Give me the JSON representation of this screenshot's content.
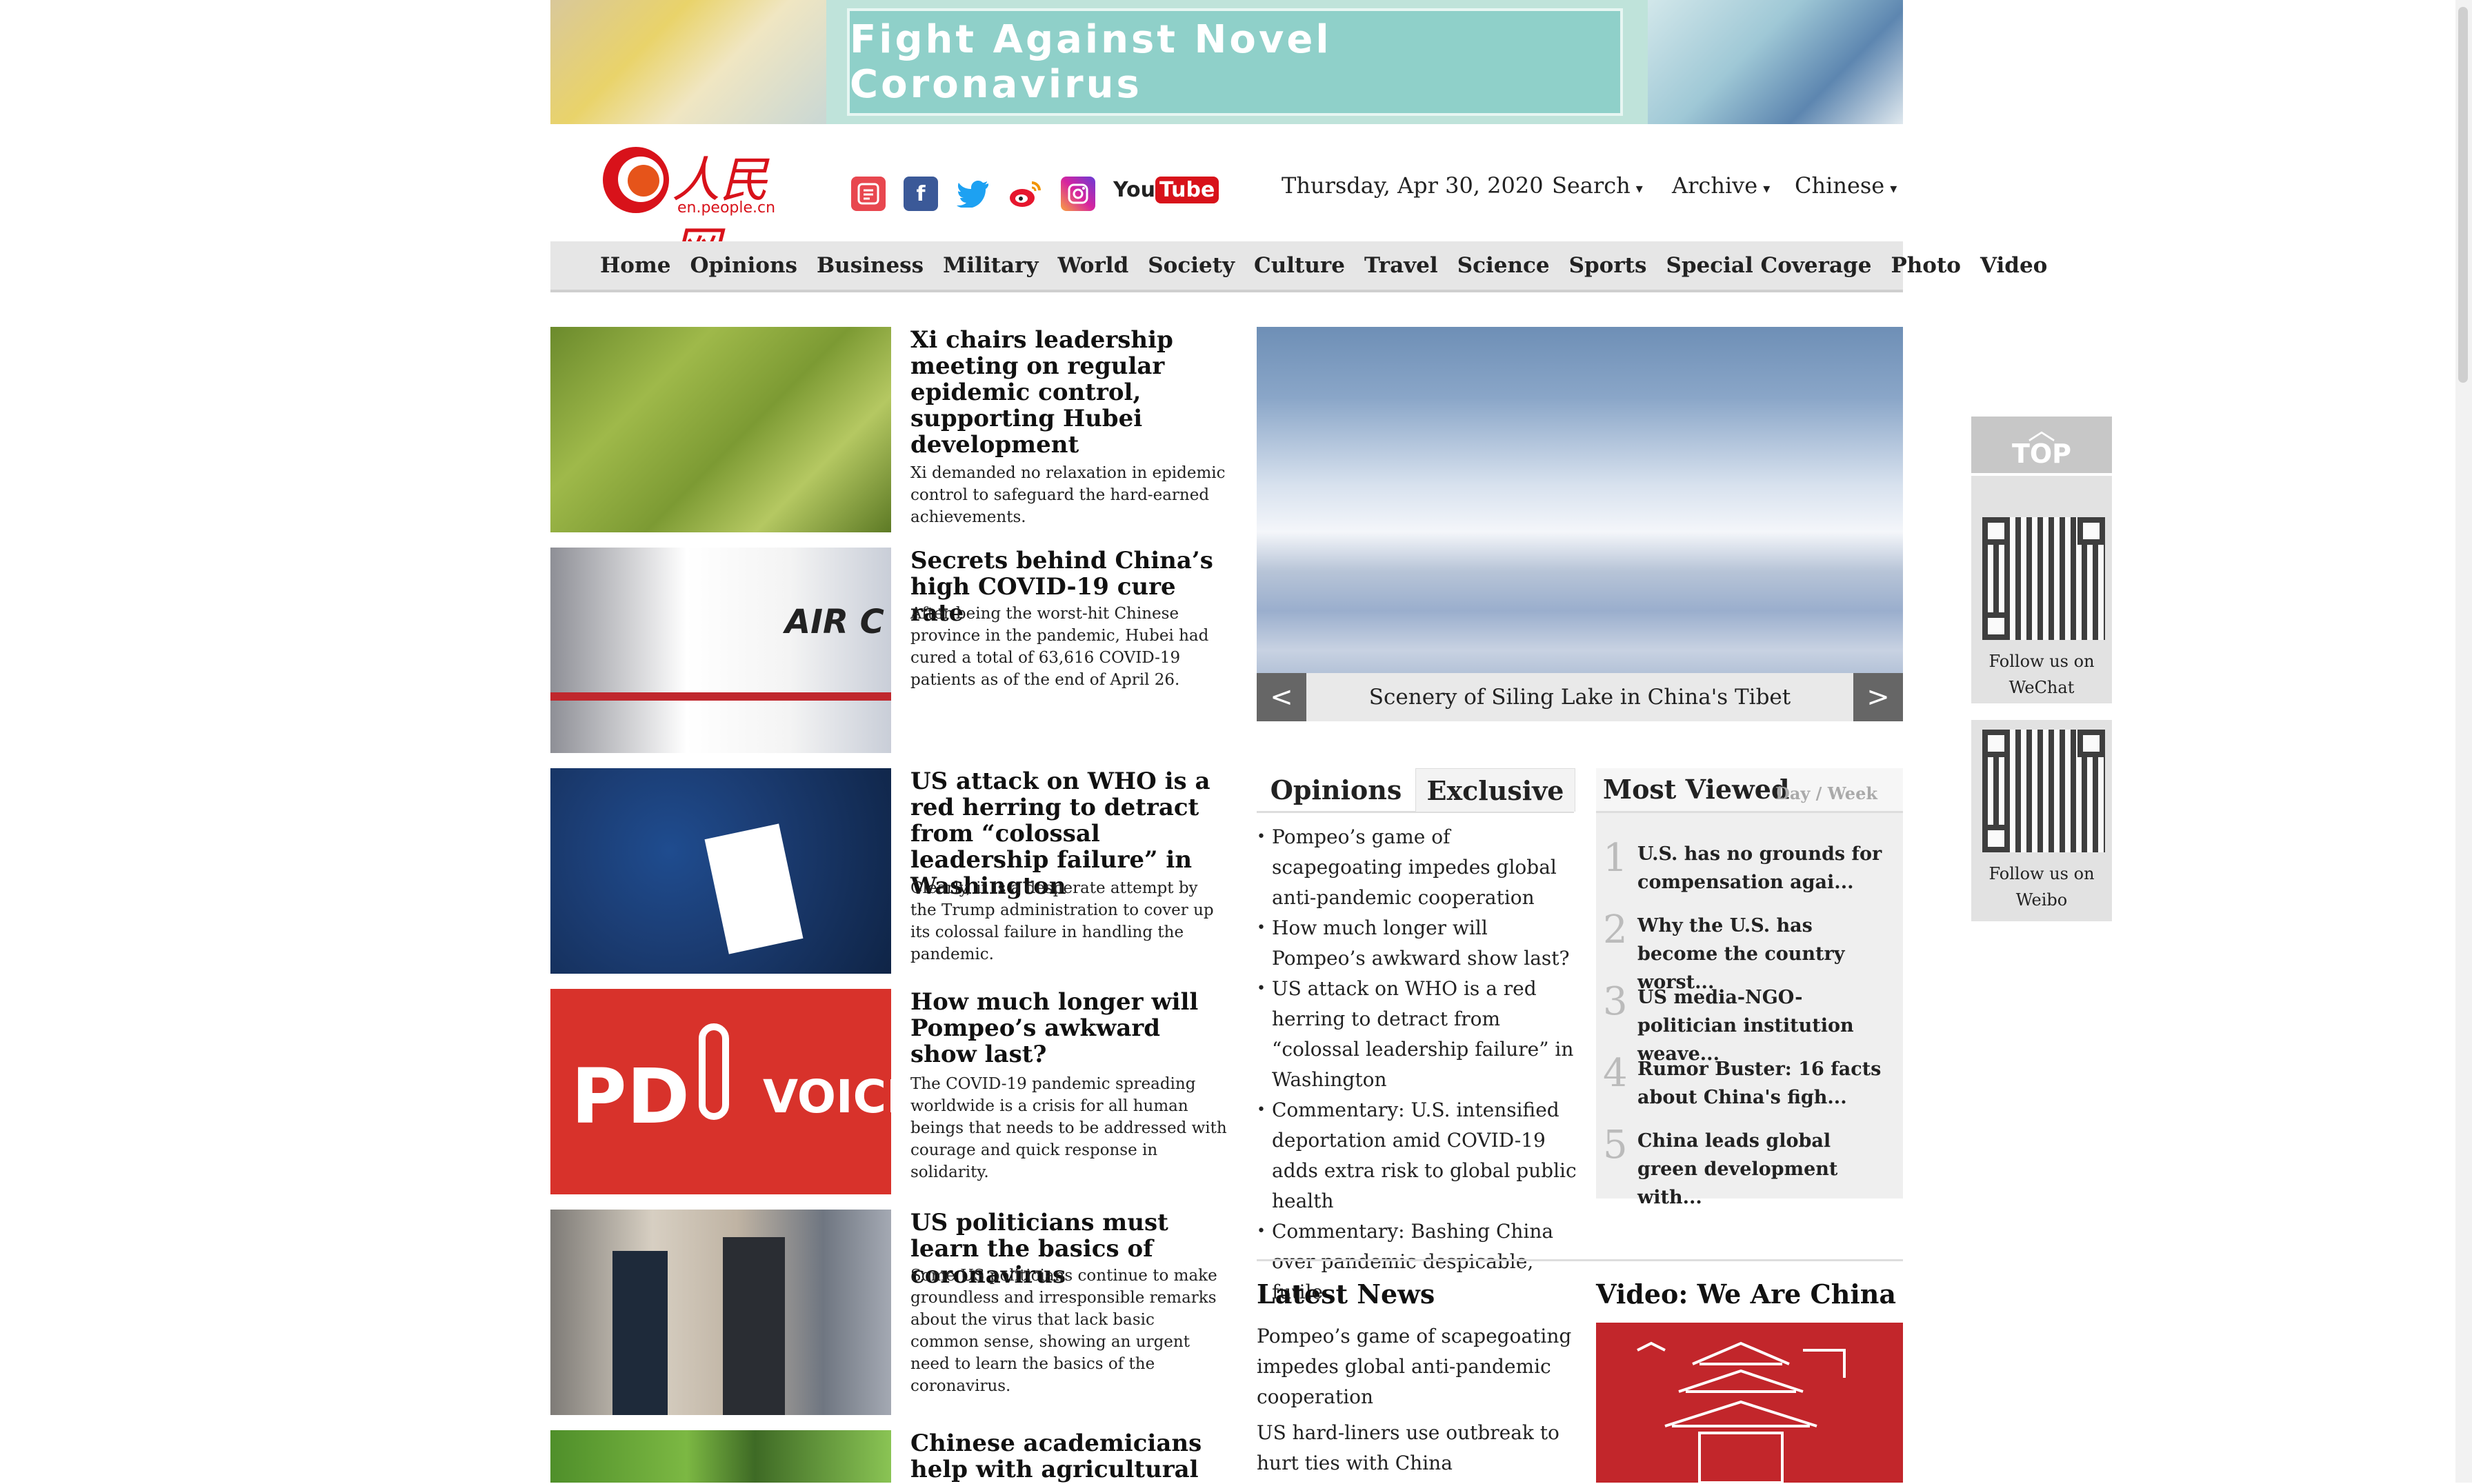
{
  "banner": {
    "text": "Fight Against Novel Coronavirus"
  },
  "logo": {
    "cn": "人民网",
    "domain": "en.people.cn"
  },
  "social_icons": [
    "people-app-icon",
    "facebook-icon",
    "twitter-icon",
    "weibo-icon",
    "instagram-icon",
    "youtube-icon"
  ],
  "youtube": {
    "you": "You",
    "tube": "Tube"
  },
  "header": {
    "date": "Thursday, Apr 30, 2020",
    "search": "Search",
    "archive": "Archive",
    "chinese": "Chinese"
  },
  "nav": [
    "Home",
    "Opinions",
    "Business",
    "Military",
    "World",
    "Society",
    "Culture",
    "Travel",
    "Science",
    "Sports",
    "Special Coverage",
    "Photo",
    "Video"
  ],
  "stories": [
    {
      "title": "Xi chairs leadership meeting on regular epidemic control, supporting Hubei development",
      "desc": "Xi demanded no relaxation in epidemic control to safeguard the hard-earned achievements."
    },
    {
      "title": "Secrets behind China’s high COVID-19 cure rate",
      "desc": "After being the worst-hit Chinese province in the pandemic, Hubei had cured a total of 63,616 COVID-19 patients as of the end of April 26."
    },
    {
      "title": "US attack on WHO is a red herring to detract from “colossal leadership failure” in Washington",
      "desc": "Clearly, it is a desperate attempt by the Trump administration to cover up its colossal failure in handling the pandemic."
    },
    {
      "title": "How much longer will Pompeo’s awkward show last?",
      "desc": "The COVID-19 pandemic spreading worldwide is a crisis for all human beings that needs to be addressed with courage and quick response in solidarity."
    },
    {
      "title": "US politicians must learn the basics of coronavirus",
      "desc": "Some US politicians continue to make groundless and irresponsible remarks about the virus that lack basic common sense, showing an urgent need to learn the basics of the coronavirus."
    },
    {
      "title": "Chinese academicians help with agricultural",
      "desc": ""
    }
  ],
  "thumb_texts": {
    "air": "AIR C",
    "pd": "PD",
    "voice": "VOICE"
  },
  "slider": {
    "caption": "Scenery of Siling Lake in China's Tibet",
    "prev": "<",
    "next": ">"
  },
  "tabs": {
    "opinions": "Opinions",
    "exclusive": "Exclusive"
  },
  "opinions_list": [
    "Pompeo’s game of scapegoating impedes global anti-pandemic cooperation",
    "How much longer will Pompeo’s awkward show last?",
    "US attack on WHO is a red herring to detract from “colossal leadership failure” in Washington",
    "Commentary: U.S. intensified deportation amid COVID-19 adds extra risk to global public health",
    "Commentary: Bashing China over pandemic despicable, futile"
  ],
  "most_viewed": {
    "title": "Most Viewed",
    "day": "Day",
    "sep": "/",
    "week": "Week",
    "items": [
      {
        "num": "1",
        "text": "U.S. has no grounds for compensation agai..."
      },
      {
        "num": "2",
        "text": "Why the U.S. has become the country worst..."
      },
      {
        "num": "3",
        "text": "US media-NGO-politician institution weave..."
      },
      {
        "num": "4",
        "text": "Rumor Buster: 16 facts about China's figh..."
      },
      {
        "num": "5",
        "text": "China leads global green development with..."
      }
    ]
  },
  "latest_news": {
    "title": "Latest News",
    "items": [
      "Pompeo’s game of scapegoating impedes global anti-pandemic cooperation",
      "US hard-liners use outbreak to hurt ties with China"
    ]
  },
  "video": {
    "title": "Video: We Are China"
  },
  "float": {
    "top": "TOP",
    "close": "×",
    "wechat": [
      "Follow us on",
      "WeChat"
    ],
    "weibo": [
      "Follow us on",
      "Weibo"
    ]
  }
}
